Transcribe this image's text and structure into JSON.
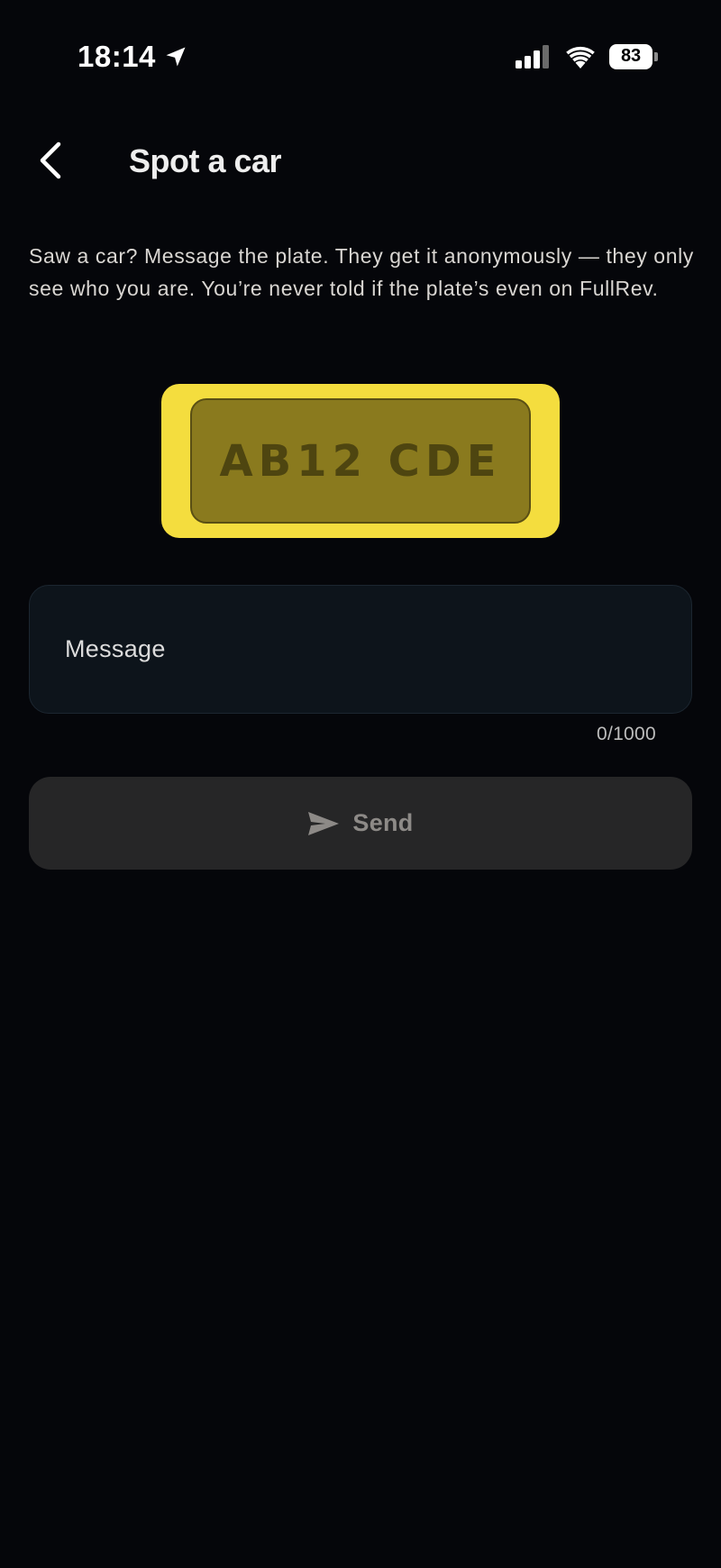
{
  "status_bar": {
    "time": "18:14",
    "battery_level": "83",
    "location_icon": "location-arrow-icon",
    "signal_icon": "cellular-signal-icon",
    "wifi_icon": "wifi-icon"
  },
  "header": {
    "title": "Spot a car",
    "back_icon": "chevron-left-icon"
  },
  "description": "Saw a car? Message the plate. They get it anonymously — they only see who you are. You’re never told if the plate’s even on FullRev.",
  "plate": {
    "number": "AB12 CDE",
    "outer_color": "#f4dd3e",
    "inner_color": "#8a7a1e"
  },
  "message": {
    "placeholder": "Message",
    "value": "",
    "counter": "0/1000"
  },
  "send": {
    "label": "Send",
    "icon": "send-icon",
    "enabled": false
  },
  "colors": {
    "background": "#05060a",
    "field_background": "#0d141b",
    "button_background": "#262627"
  }
}
